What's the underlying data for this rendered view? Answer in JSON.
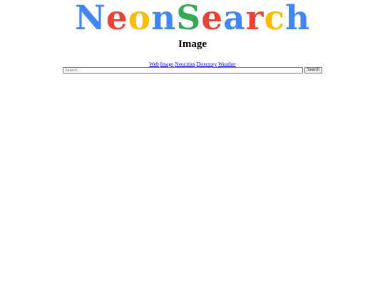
{
  "logo": {
    "letters": [
      {
        "char": "N",
        "color": "#4285f4"
      },
      {
        "char": "e",
        "color": "#ea4335"
      },
      {
        "char": "o",
        "color": "#fbbc05"
      },
      {
        "char": "n",
        "color": "#4285f4"
      },
      {
        "char": "S",
        "color": "#34a853"
      },
      {
        "char": "e",
        "color": "#ea4335"
      },
      {
        "char": "a",
        "color": "#4285f4"
      },
      {
        "char": "r",
        "color": "#ea4335"
      },
      {
        "char": "c",
        "color": "#fbbc05"
      },
      {
        "char": "h",
        "color": "#4285f4"
      }
    ]
  },
  "subtitle": "Image",
  "nav": {
    "links": [
      "Web",
      "Image",
      "Neocities",
      "Directory",
      "Weather"
    ]
  },
  "search": {
    "placeholder": "Search...",
    "value": "",
    "button_label": "Search"
  }
}
